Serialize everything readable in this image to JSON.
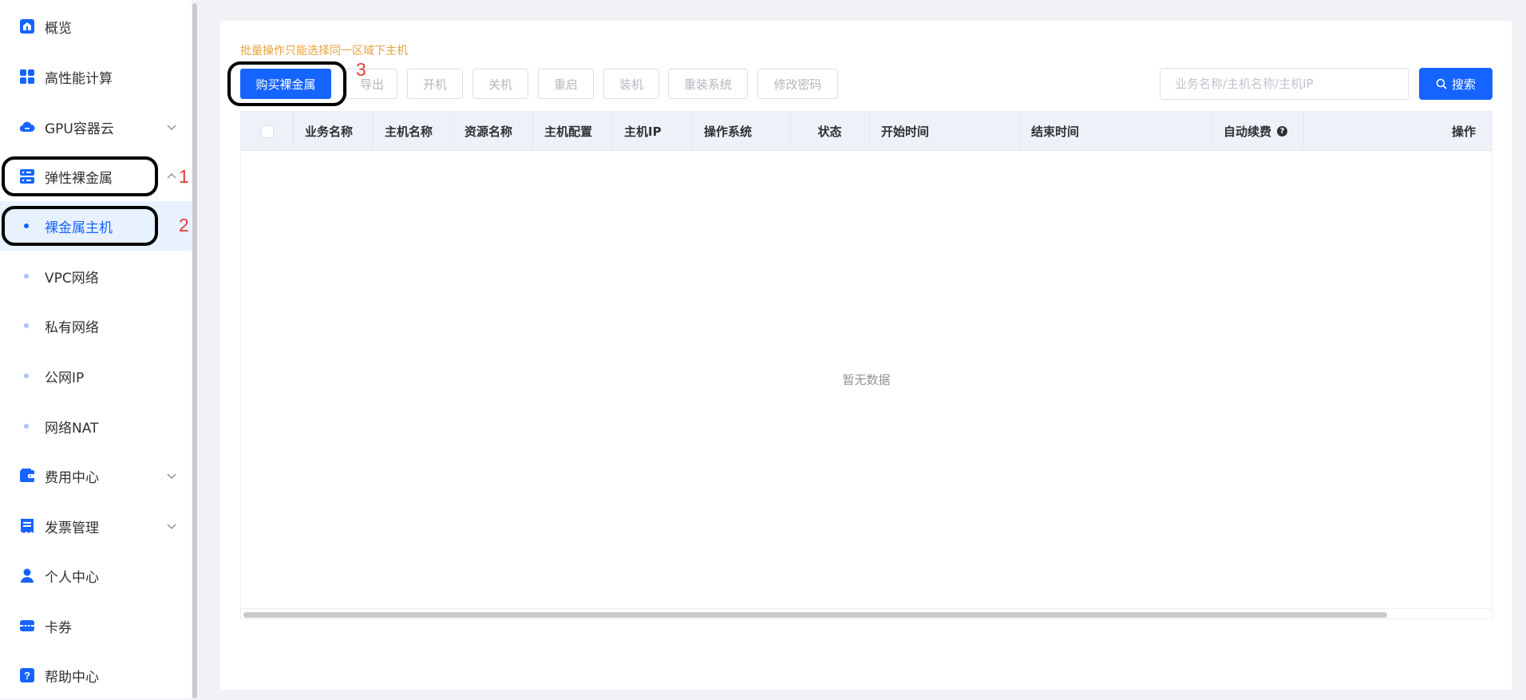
{
  "sidebar": {
    "items": [
      {
        "label": "概览",
        "icon": "home-icon"
      },
      {
        "label": "高性能计算",
        "icon": "grid-icon"
      },
      {
        "label": "GPU容器云",
        "icon": "cloud-icon",
        "chevron": "chevron-down-icon"
      },
      {
        "label": "弹性裸金属",
        "icon": "server-icon",
        "chevron": "chevron-up-icon"
      },
      {
        "label": "裸金属主机",
        "sub": true,
        "active": true
      },
      {
        "label": "VPC网络",
        "sub": true
      },
      {
        "label": "私有网络",
        "sub": true
      },
      {
        "label": "公网IP",
        "sub": true
      },
      {
        "label": "网络NAT",
        "sub": true
      },
      {
        "label": "费用中心",
        "icon": "wallet-icon",
        "chevron": "chevron-down-icon"
      },
      {
        "label": "发票管理",
        "icon": "invoice-icon",
        "chevron": "chevron-down-icon"
      },
      {
        "label": "个人中心",
        "icon": "user-icon"
      },
      {
        "label": "卡券",
        "icon": "coupon-icon"
      },
      {
        "label": "帮助中心",
        "icon": "help-icon"
      }
    ]
  },
  "annotations": {
    "one": "1",
    "two": "2",
    "three": "3"
  },
  "main": {
    "notice": "批量操作只能选择同一区域下主机",
    "toolbar": {
      "buy": "购买裸金属",
      "export": "导出",
      "power_on": "开机",
      "power_off": "关机",
      "restart": "重启",
      "install": "装机",
      "reinstall": "重装系统",
      "change_password": "修改密码"
    },
    "search": {
      "placeholder": "业务名称/主机名称/主机IP",
      "button": "搜索"
    },
    "table": {
      "columns": [
        "业务名称",
        "主机名称",
        "资源名称",
        "主机配置",
        "主机IP",
        "操作系统",
        "状态",
        "开始时间",
        "结束时间",
        "自动续费",
        "操作"
      ],
      "empty_text": "暂无数据"
    }
  },
  "colors": {
    "primary": "#1664ff",
    "notice": "#e6a23c",
    "annotation": "#e53935"
  }
}
